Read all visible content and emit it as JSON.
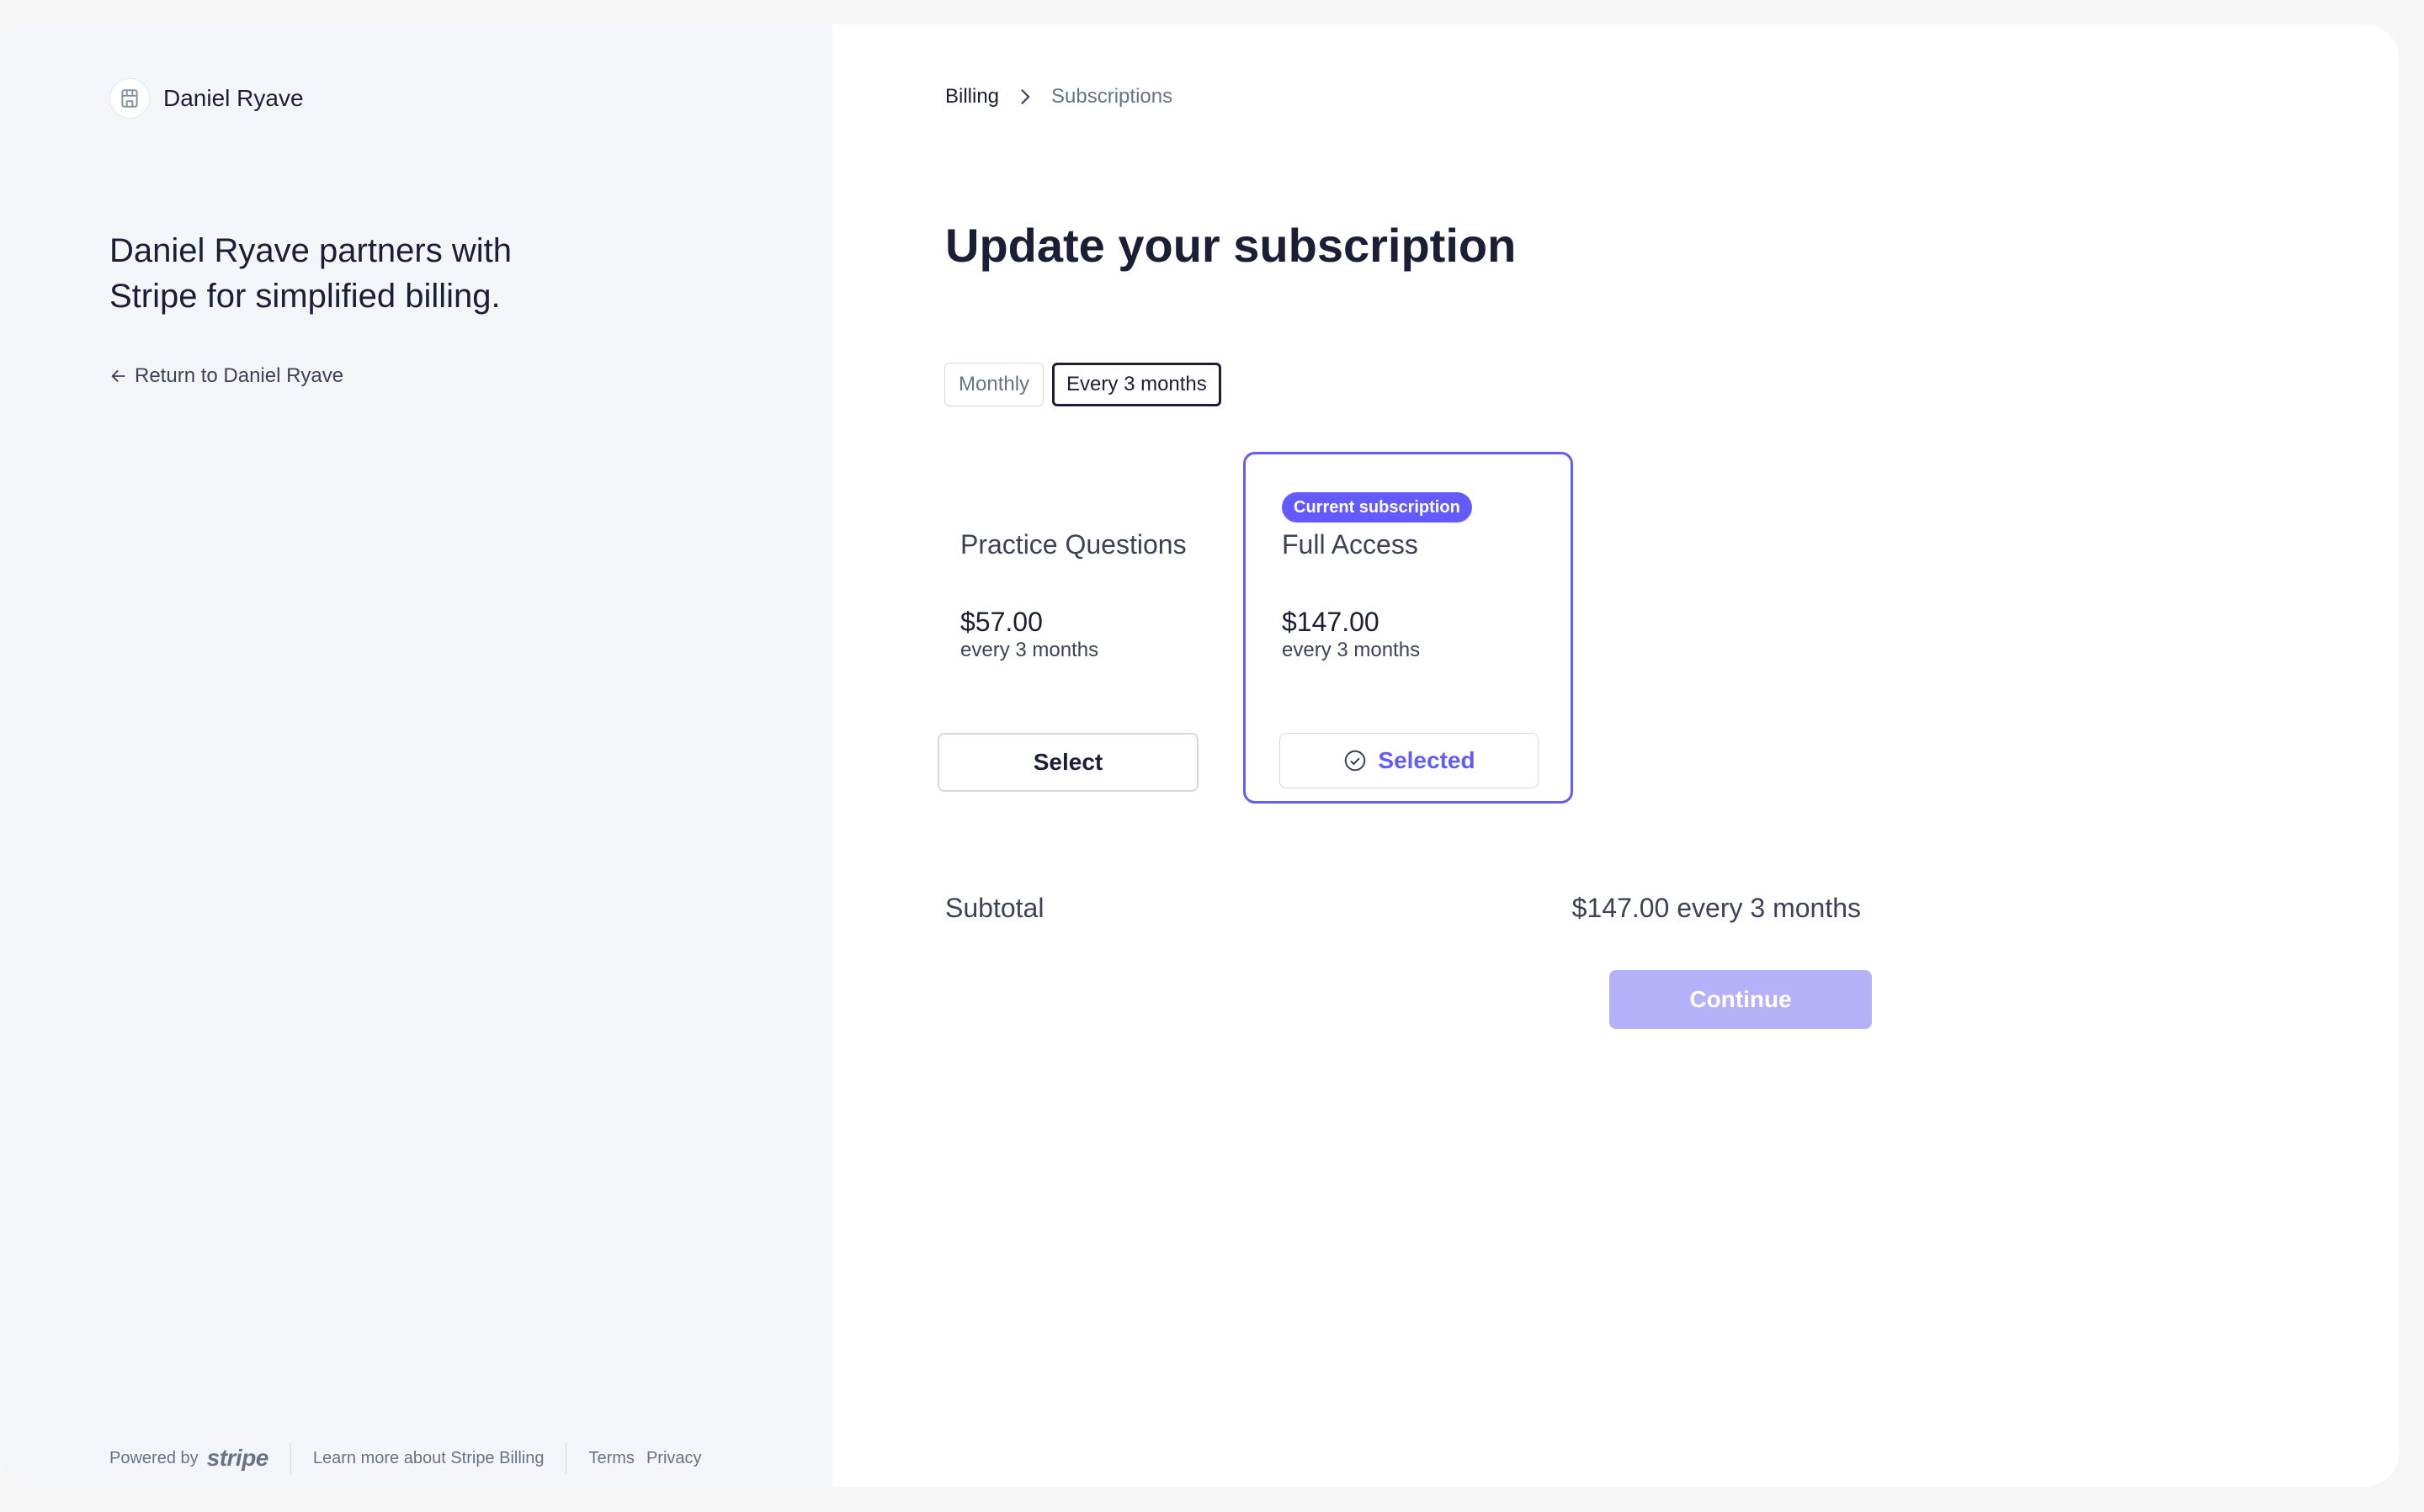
{
  "merchant": {
    "name": "Daniel Ryave",
    "tagline": "Daniel Ryave partners with Stripe for simplified billing.",
    "return_label": "Return to Daniel Ryave"
  },
  "footer": {
    "powered_by": "Powered by",
    "brand": "stripe",
    "learn_more": "Learn more about Stripe Billing",
    "terms": "Terms",
    "privacy": "Privacy"
  },
  "breadcrumb": {
    "billing": "Billing",
    "current": "Subscriptions"
  },
  "page": {
    "title": "Update your subscription"
  },
  "interval_toggle": {
    "options": [
      "Monthly",
      "Every 3 months"
    ],
    "selected": "Every 3 months"
  },
  "plans": [
    {
      "name": "Practice Questions",
      "price": "$57.00",
      "interval": "every 3 months",
      "button_label": "Select",
      "badge": ""
    },
    {
      "name": "Full Access",
      "price": "$147.00",
      "interval": "every 3 months",
      "button_label": "Selected",
      "badge": "Current subscription"
    }
  ],
  "summary": {
    "subtotal_label": "Subtotal",
    "subtotal_value": "$147.00 every 3 months",
    "continue_label": "Continue"
  },
  "colors": {
    "accent": "#635bff",
    "accent_disabled": "#b4b1f8",
    "text_primary": "#1a1f36",
    "text_secondary": "#697386"
  },
  "icons": {
    "merchant_logo": "storefront-icon",
    "return": "arrow-left-icon",
    "breadcrumb_separator": "chevron-right-icon",
    "selected": "check-circle-icon"
  }
}
